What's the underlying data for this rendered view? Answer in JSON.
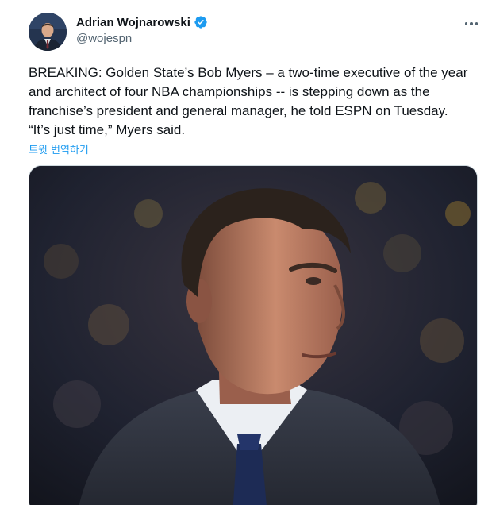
{
  "author": {
    "display_name": "Adrian Wojnarowski",
    "handle": "@wojespn",
    "verified": true,
    "verified_color": "#1d9bf0"
  },
  "tweet": {
    "text_lines": [
      "BREAKING: Golden State’s Bob Myers – a two-time executive of the year",
      "and architect of four NBA championships -- is stepping down as the",
      "franchise’s president and general manager, he told ESPN on Tuesday.",
      "“It’s just time,” Myers said."
    ],
    "translate_label": "트윗 번역하기"
  },
  "icons": {
    "more": "more-horizontal-icon",
    "verified": "verified-badge-icon"
  },
  "colors": {
    "link": "#1d9bf0",
    "secondary_text": "#536471",
    "primary_text": "#0f1419"
  }
}
